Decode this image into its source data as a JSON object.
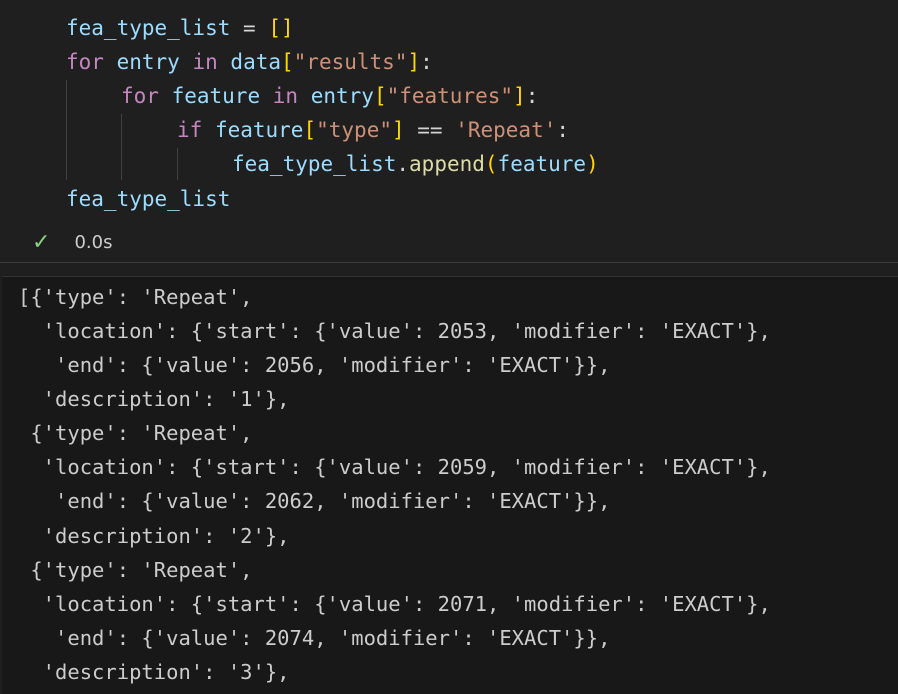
{
  "colors": {
    "keyword": "#c586c0",
    "variable": "#9cdcfe",
    "function": "#dcdcaa",
    "string": "#ce9178",
    "bracket_level1": "#ffd700",
    "bracket_level2": "#da70d6",
    "success": "#89d185",
    "background": "#1f1f1f",
    "output_background": "#181818"
  },
  "code": {
    "l1": {
      "var": "fea_type_list",
      "op": " = ",
      "br": "[]"
    },
    "l2": {
      "kw1": "for",
      "var1": "entry",
      "kw2": "in",
      "var2": "data",
      "br_open": "[",
      "str": "\"results\"",
      "br_close": "]",
      "colon": ":"
    },
    "l3": {
      "kw1": "for",
      "var1": "feature",
      "kw2": "in",
      "var2": "entry",
      "br_open": "[",
      "str": "\"features\"",
      "br_close": "]",
      "colon": ":"
    },
    "l4": {
      "kw": "if",
      "var": "feature",
      "br_open": "[",
      "str1": "\"type\"",
      "br_close": "]",
      "op": " == ",
      "str2": "'Repeat'",
      "colon": ":"
    },
    "l5": {
      "var1": "fea_type_list",
      "dot": ".",
      "fn": "append",
      "br_open": "(",
      "var2": "feature",
      "br_close": ")"
    },
    "l6": {
      "var": "fea_type_list"
    }
  },
  "status": {
    "icon": "check-icon",
    "check_glyph": "✓",
    "duration": "0.0s"
  },
  "output": {
    "lines": [
      "[{'type': 'Repeat',",
      "  'location': {'start': {'value': 2053, 'modifier': 'EXACT'},",
      "   'end': {'value': 2056, 'modifier': 'EXACT'}},",
      "  'description': '1'},",
      " {'type': 'Repeat',",
      "  'location': {'start': {'value': 2059, 'modifier': 'EXACT'},",
      "   'end': {'value': 2062, 'modifier': 'EXACT'}},",
      "  'description': '2'},",
      " {'type': 'Repeat',",
      "  'location': {'start': {'value': 2071, 'modifier': 'EXACT'},",
      "   'end': {'value': 2074, 'modifier': 'EXACT'}},",
      "  'description': '3'},"
    ]
  }
}
